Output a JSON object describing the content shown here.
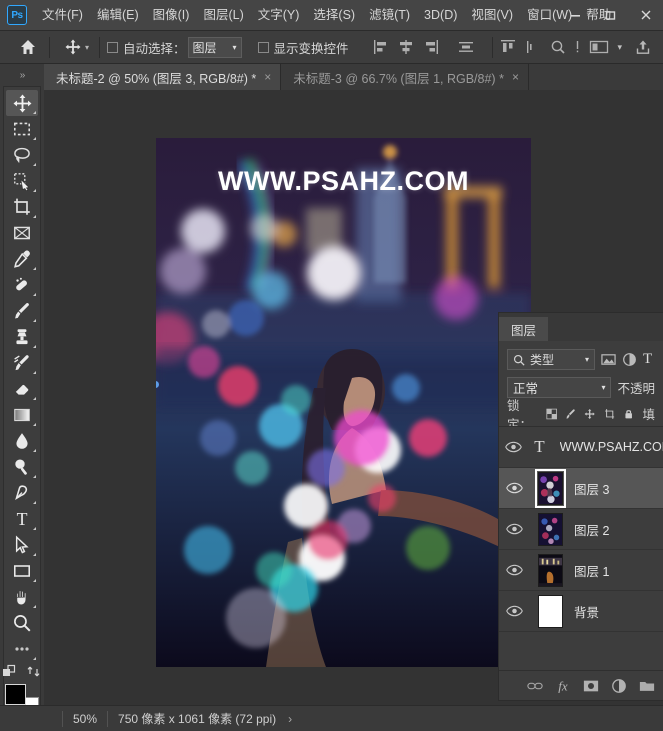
{
  "app": {
    "logo": "Ps",
    "menu": [
      {
        "label": "文件(F)",
        "name": "menu-file"
      },
      {
        "label": "编辑(E)",
        "name": "menu-edit"
      },
      {
        "label": "图像(I)",
        "name": "menu-image"
      },
      {
        "label": "图层(L)",
        "name": "menu-layer"
      },
      {
        "label": "文字(Y)",
        "name": "menu-type"
      },
      {
        "label": "选择(S)",
        "name": "menu-select"
      },
      {
        "label": "滤镜(T)",
        "name": "menu-filter"
      },
      {
        "label": "3D(D)",
        "name": "menu-3d"
      },
      {
        "label": "视图(V)",
        "name": "menu-view"
      },
      {
        "label": "窗口(W)",
        "name": "menu-window"
      },
      {
        "label": "帮助",
        "name": "menu-help"
      }
    ],
    "window_controls": {
      "minimize": "minimize-icon",
      "maximize": "maximize-icon",
      "close": "close-icon"
    }
  },
  "options_bar": {
    "home_icon": "home-icon",
    "active_tool_icon": "move-tool-icon",
    "tool_caret": "chevron-down-icon",
    "auto_select_label": "自动选择：",
    "auto_select_checked": false,
    "auto_select_scope": "图层",
    "show_transform_label": "显示变换控件",
    "show_transform_checked": false,
    "align_icons": [
      "align-left-icon",
      "align-center-h-icon",
      "align-right-icon",
      "distribute-icon"
    ],
    "extra_icons": [
      "align-top-icon",
      "align-vertical-icon",
      "search-icon",
      "three-d-mode-icon",
      "chevron-down-icon",
      "share-icon"
    ]
  },
  "tabs": [
    {
      "label": "未标题-2 @ 50% (图层 3, RGB/8#) *",
      "close": "×",
      "active": true
    },
    {
      "label": "未标题-3 @ 66.7% (图层 1, RGB/8#) *",
      "close": "×",
      "active": false
    }
  ],
  "toolbox": {
    "collapse_arrows": "»",
    "tools": [
      {
        "name": "move-tool",
        "selected": true,
        "has_submenu": true
      },
      {
        "name": "rectangular-marquee-tool",
        "selected": false,
        "has_submenu": true
      },
      {
        "name": "lasso-tool",
        "selected": false,
        "has_submenu": true
      },
      {
        "name": "quick-selection-tool",
        "selected": false,
        "has_submenu": true
      },
      {
        "name": "crop-tool",
        "selected": false,
        "has_submenu": true
      },
      {
        "name": "frame-tool",
        "selected": false,
        "has_submenu": false
      },
      {
        "name": "eyedropper-tool",
        "selected": false,
        "has_submenu": true
      },
      {
        "name": "spot-healing-brush-tool",
        "selected": false,
        "has_submenu": true
      },
      {
        "name": "brush-tool",
        "selected": false,
        "has_submenu": true
      },
      {
        "name": "clone-stamp-tool",
        "selected": false,
        "has_submenu": true
      },
      {
        "name": "history-brush-tool",
        "selected": false,
        "has_submenu": true
      },
      {
        "name": "eraser-tool",
        "selected": false,
        "has_submenu": true
      },
      {
        "name": "gradient-tool",
        "selected": false,
        "has_submenu": true
      },
      {
        "name": "blur-tool",
        "selected": false,
        "has_submenu": true
      },
      {
        "name": "dodge-tool",
        "selected": false,
        "has_submenu": true
      },
      {
        "name": "pen-tool",
        "selected": false,
        "has_submenu": true
      },
      {
        "name": "horizontal-type-tool",
        "selected": false,
        "has_submenu": true
      },
      {
        "name": "path-selection-tool",
        "selected": false,
        "has_submenu": true
      },
      {
        "name": "rectangle-tool",
        "selected": false,
        "has_submenu": true
      },
      {
        "name": "hand-tool",
        "selected": false,
        "has_submenu": true
      },
      {
        "name": "zoom-tool",
        "selected": false,
        "has_submenu": false
      },
      {
        "name": "edit-toolbar-tool",
        "selected": false,
        "has_submenu": true
      }
    ],
    "foreground_color": "#000000",
    "background_color": "#ffffff",
    "swap_icon": "swap-colors-icon",
    "default_icon": "default-colors-icon"
  },
  "canvas": {
    "watermark": "WWW.PSAHZ.COM",
    "zoom_display": "50%",
    "bg_color": "#333333"
  },
  "status_bar": {
    "zoom": "50%",
    "doc_size": "750 像素 x 1061 像素 (72 ppi)",
    "chevron": "›"
  },
  "layers_panel": {
    "tab_label": "图层",
    "filter": {
      "search_icon": "search-icon",
      "value": "类型",
      "caret": "chevron-down-icon",
      "kind_icons": [
        "pixel-filter-icon",
        "adjustment-filter-icon",
        "type-filter-icon"
      ]
    },
    "blend_mode": "正常",
    "blend_caret": "chevron-down-icon",
    "opacity_label": "不透明",
    "lock_label": "锁定：",
    "lock_icons": [
      "lock-transparent-icon",
      "lock-image-icon",
      "lock-position-icon",
      "lock-artboard-icon",
      "lock-all-icon"
    ],
    "fill_label": "填",
    "layers": [
      {
        "name": "WWW.PSAHZ.COM",
        "type": "text",
        "visible": true,
        "selected": false,
        "thumb": "type"
      },
      {
        "name": "图层 3",
        "type": "image",
        "visible": true,
        "selected": true,
        "thumb": "bokeh-portrait"
      },
      {
        "name": "图层 2",
        "type": "image",
        "visible": true,
        "selected": false,
        "thumb": "bokeh-lights"
      },
      {
        "name": "图层 1",
        "type": "image",
        "visible": true,
        "selected": false,
        "thumb": "city-night"
      },
      {
        "name": "背景",
        "type": "image",
        "visible": true,
        "selected": false,
        "thumb": "white"
      }
    ],
    "bottom_icons": [
      {
        "name": "link-layers-icon",
        "glyph": "∞"
      },
      {
        "name": "layer-style-fx-icon",
        "glyph": "fx"
      },
      {
        "name": "add-layer-mask-icon",
        "glyph": "◉"
      },
      {
        "name": "new-fill-adjustment-icon",
        "glyph": "◑"
      },
      {
        "name": "new-group-icon",
        "glyph": "▭"
      }
    ]
  },
  "colors": {
    "panel_bg": "#3d3d3d",
    "menu_bg": "#454545",
    "canvas_bg": "#333333",
    "accent_blue": "#31a8ff",
    "selected_row": "#565656"
  }
}
